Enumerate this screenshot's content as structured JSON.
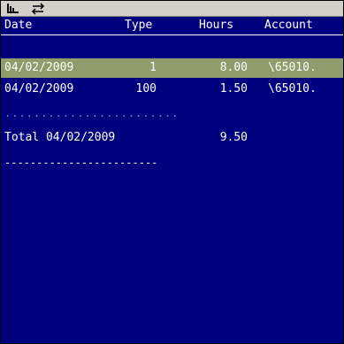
{
  "toolbar": {
    "buttons": [
      {
        "icon": "chart-icon"
      },
      {
        "icon": "swap-arrows-icon"
      }
    ]
  },
  "table": {
    "headers": {
      "date": "Date",
      "type": "Type",
      "hours": "Hours",
      "account": "Account"
    },
    "rows": [
      {
        "date": "04/02/2009",
        "type": "1",
        "hours": "8.00",
        "account": "\\65010."
      },
      {
        "date": "04/02/2009",
        "type": "100",
        "hours": "1.50",
        "account": "\\65010."
      }
    ]
  },
  "summary": {
    "dots": "........................",
    "label": "Total 04/02/2009",
    "hours": "9.50",
    "underline": "------------------------"
  },
  "colors": {
    "background": "#00007e",
    "selected_row": "#8f9c6b",
    "text": "#ffffff",
    "toolbar": "#d4d0c8"
  }
}
